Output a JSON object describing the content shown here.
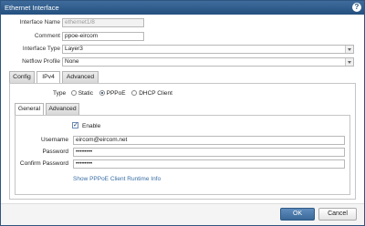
{
  "dialog": {
    "title": "Ethernet Interface",
    "help_icon": "question-mark-icon"
  },
  "fields": {
    "interface_name": {
      "label": "Interface Name",
      "value": "ethernet1/8"
    },
    "comment": {
      "label": "Comment",
      "value": "ppoe-eircom"
    },
    "interface_type": {
      "label": "Interface Type",
      "value": "Layer3"
    },
    "netflow_profile": {
      "label": "Netflow Profile",
      "value": "None"
    }
  },
  "tabs": [
    "Config",
    "IPv4",
    "Advanced"
  ],
  "ipv4": {
    "type_label": "Type",
    "type_options": [
      {
        "label": "Static",
        "selected": false
      },
      {
        "label": "PPPoE",
        "selected": true
      },
      {
        "label": "DHCP Client",
        "selected": false
      }
    ],
    "subtabs": [
      "General",
      "Advanced"
    ],
    "enable_label": "Enable",
    "enable_checked": true,
    "username": {
      "label": "Username",
      "value": "eircom@eircom.net"
    },
    "password": {
      "label": "Password",
      "value": "••••••••"
    },
    "confirm_password": {
      "label": "Confirm Password",
      "value": "••••••••"
    },
    "runtime_link": "Show PPPoE Client Runtime Info"
  },
  "buttons": {
    "ok": "OK",
    "cancel": "Cancel"
  }
}
